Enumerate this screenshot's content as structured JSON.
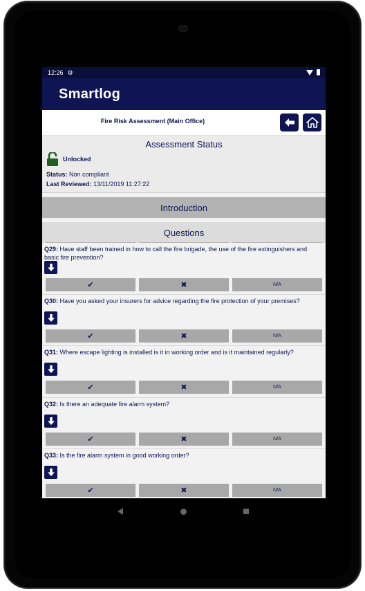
{
  "status_bar": {
    "time": "12:26"
  },
  "app": {
    "title": "Smartlog"
  },
  "page": {
    "title": "Fire Risk Assessment (Main Office)"
  },
  "assessment": {
    "heading": "Assessment Status",
    "lock_label": "Unlocked",
    "status_label": "Status:",
    "status_value": "Non compliant",
    "reviewed_label": "Last Reviewed:",
    "reviewed_value": "13/11/2019 11:27:22"
  },
  "sections": {
    "introduction": "Introduction",
    "questions": "Questions"
  },
  "answer_labels": {
    "yes": "✔",
    "no": "✖",
    "na": "N/A"
  },
  "questions": [
    {
      "num": "Q29:",
      "text": "Have staff been trained in how to call the fire brigade, the use of the fire extinguishers and basic fire prevention?"
    },
    {
      "num": "Q30:",
      "text": "Have you asked your insurers for advice regarding the fire protection of your premises?"
    },
    {
      "num": "Q31:",
      "text": "Where escape lighting is installed is it in working order and is it maintained regularly?"
    },
    {
      "num": "Q32:",
      "text": "Is there an adequate fire alarm system?"
    },
    {
      "num": "Q33:",
      "text": "Is the fire alarm system in good working order?"
    }
  ],
  "colors": {
    "navy": "#0f1552",
    "statusbar": "#0a0f3a",
    "button_grey": "#a8a8a8",
    "lock_green": "#1e5e1e"
  },
  "icons": {
    "back": "arrow-left-icon",
    "home": "home-icon",
    "lock": "unlocked-padlock-icon",
    "expand": "arrow-down-icon"
  }
}
